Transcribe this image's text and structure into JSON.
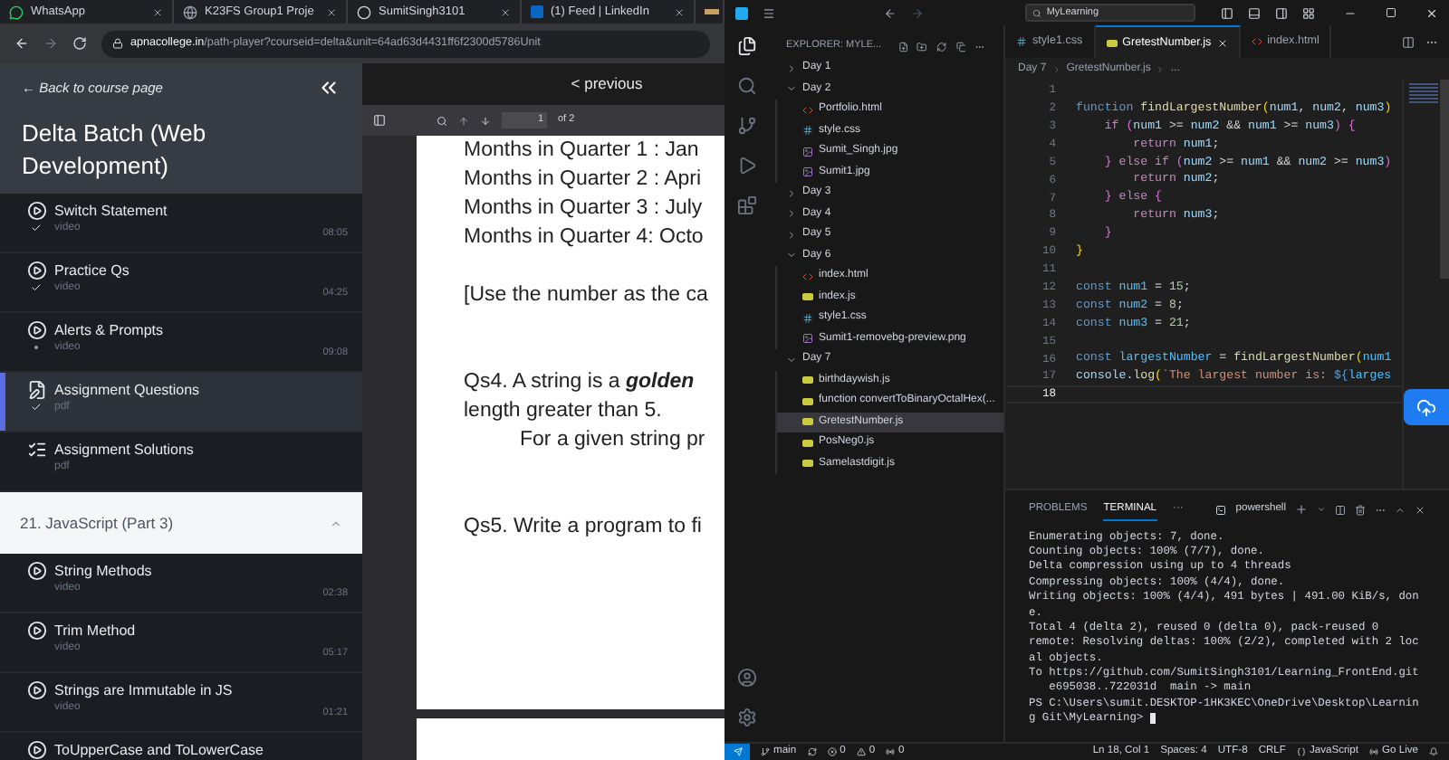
{
  "browser": {
    "tabs": [
      {
        "kind": "chat",
        "title": "WhatsApp"
      },
      {
        "kind": "globe",
        "title": "K23FS Group1 Proje"
      },
      {
        "kind": "ring",
        "title": "SumitSingh3101"
      },
      {
        "kind": "square",
        "title": "(1) Feed | LinkedIn"
      },
      {
        "kind": "bar"
      }
    ],
    "address": {
      "host": "apnacollege.in",
      "path": "/path-player?courseid=delta&unit=64ad63d4431ff6f2300d5786Unit"
    }
  },
  "course": {
    "back": "← Back to course page",
    "title": "Delta Batch (Web Development)",
    "lessons": [
      {
        "kind": "video",
        "title": "Switch Statement",
        "type": "video",
        "duration": "08:05",
        "done": true,
        "in_progress": false,
        "selected": false
      },
      {
        "kind": "video",
        "title": "Practice Qs",
        "type": "video",
        "duration": "04:25",
        "done": true,
        "in_progress": false,
        "selected": false
      },
      {
        "kind": "video",
        "title": "Alerts & Prompts",
        "type": "video",
        "duration": "09:08",
        "done": false,
        "in_progress": true,
        "selected": false
      },
      {
        "kind": "assignment",
        "title": "Assignment Questions",
        "type": "pdf",
        "done": true,
        "in_progress": false,
        "selected": true
      },
      {
        "kind": "solutions",
        "title": "Assignment Solutions",
        "type": "pdf",
        "done": false,
        "in_progress": false,
        "selected": false
      }
    ],
    "section": {
      "title": "21. JavaScript (Part 3)",
      "expanded": true,
      "lessons": [
        {
          "kind": "video",
          "title": "String Methods",
          "type": "video",
          "duration": "02:38",
          "done": false,
          "in_progress": false,
          "selected": false
        },
        {
          "kind": "video",
          "title": "Trim Method",
          "type": "video",
          "duration": "05:17",
          "done": false,
          "in_progress": false,
          "selected": false
        },
        {
          "kind": "video",
          "title": "Strings are Immutable in JS",
          "type": "video",
          "duration": "01:21",
          "done": false,
          "in_progress": false,
          "selected": false
        },
        {
          "kind": "video",
          "title": "ToUpperCase and ToLowerCase",
          "selected": false
        }
      ]
    }
  },
  "pdf": {
    "previous": "< previous",
    "page": "1",
    "of": "of 2",
    "paragraphs": [
      {
        "kind": "line",
        "text": "Months in Quarter 1 : Jan"
      },
      {
        "kind": "line",
        "text": "Months in Quarter 2 : Apri"
      },
      {
        "kind": "line",
        "text": "Months in Quarter 3 : July"
      },
      {
        "kind": "line",
        "text": "Months in Quarter 4: Octo"
      },
      {
        "kind": "gap"
      },
      {
        "kind": "line",
        "text": "[Use the number as the ca"
      },
      {
        "kind": "gap"
      },
      {
        "kind": "gap"
      },
      {
        "kind": "line",
        "text": "Qs4. A string is a **golden**"
      },
      {
        "kind": "line",
        "text": "length greater than 5."
      },
      {
        "kind": "indent",
        "text": "For a given string pr"
      },
      {
        "kind": "gap"
      },
      {
        "kind": "gap"
      },
      {
        "kind": "line",
        "text": "Qs5. Write a program to fi"
      }
    ]
  },
  "vscode": {
    "search": "MyLearning",
    "explorer_title": "EXPLORER: MYLE...",
    "tree": [
      {
        "name": "Day 1",
        "expanded": false,
        "selected": false
      },
      {
        "name": "Day 2",
        "expanded": true,
        "selected": false,
        "children": [
          {
            "name": "Portfolio.html",
            "kind": "html",
            "selected": false
          },
          {
            "name": "style.css",
            "kind": "css",
            "selected": false
          },
          {
            "name": "Sumit_Singh.jpg",
            "kind": "image",
            "selected": false
          },
          {
            "name": "Sumit1.jpg",
            "kind": "image",
            "selected": false
          }
        ]
      },
      {
        "name": "Day 3",
        "expanded": false,
        "selected": false
      },
      {
        "name": "Day 4",
        "expanded": false,
        "selected": false
      },
      {
        "name": "Day 5",
        "expanded": false,
        "selected": false
      },
      {
        "name": "Day 6",
        "expanded": true,
        "selected": false,
        "children": [
          {
            "name": "index.html",
            "kind": "html",
            "selected": false
          },
          {
            "name": "index.js",
            "kind": "js",
            "selected": false
          },
          {
            "name": "style1.css",
            "kind": "css",
            "selected": false
          },
          {
            "name": "Sumit1-removebg-preview.png",
            "kind": "image",
            "selected": false
          }
        ]
      },
      {
        "name": "Day 7",
        "expanded": true,
        "selected": false,
        "children": [
          {
            "name": "birthdaywish.js",
            "kind": "js",
            "selected": false
          },
          {
            "name": "function convertToBinaryOctalHex(...",
            "kind": "js",
            "selected": false
          },
          {
            "name": "GretestNumber.js",
            "kind": "js",
            "selected": true
          },
          {
            "name": "PosNeg0.js",
            "kind": "js",
            "selected": false
          },
          {
            "name": "Samelastdigit.js",
            "kind": "js",
            "selected": false
          }
        ]
      }
    ],
    "tabs": [
      {
        "name": "style1.css",
        "kind": "css",
        "selected": false
      },
      {
        "name": "GretestNumber.js",
        "kind": "js",
        "selected": true
      },
      {
        "name": "index.html",
        "kind": "html",
        "selected": false
      }
    ],
    "breadcrumb": [
      "Day 7",
      "GretestNumber.js",
      "..."
    ],
    "code": [
      {
        "number": "1",
        "current": false
      },
      {
        "number": "2",
        "current": false,
        "tokens": [
          {
            "kind": "storage",
            "text": "function"
          },
          {
            "kind": "fn",
            "text": " findLargestNumber"
          },
          {
            "kind": "bracket1",
            "text": "("
          },
          {
            "kind": "var",
            "text": "num1"
          },
          {
            "kind": "plain",
            "text": ", "
          },
          {
            "kind": "var",
            "text": "num2"
          },
          {
            "kind": "plain",
            "text": ", "
          },
          {
            "kind": "var",
            "text": "num3"
          },
          {
            "kind": "bracket1",
            "text": ")"
          }
        ]
      },
      {
        "number": "3",
        "current": false,
        "tokens": [
          {
            "kind": "control",
            "text": "    if"
          },
          {
            "kind": "bracket2",
            "text": " ("
          },
          {
            "kind": "var",
            "text": "num1"
          },
          {
            "kind": "plain",
            "text": " >= "
          },
          {
            "kind": "var",
            "text": "num2"
          },
          {
            "kind": "plain",
            "text": " && "
          },
          {
            "kind": "var",
            "text": "num1"
          },
          {
            "kind": "plain",
            "text": " >= "
          },
          {
            "kind": "var",
            "text": "num3"
          },
          {
            "kind": "bracket2",
            "text": ") {"
          }
        ]
      },
      {
        "number": "4",
        "current": false,
        "tokens": [
          {
            "kind": "control",
            "text": "        return"
          },
          {
            "kind": "var",
            "text": " num1"
          },
          {
            "kind": "plain",
            "text": ";"
          }
        ]
      },
      {
        "number": "5",
        "current": false,
        "tokens": [
          {
            "kind": "bracket2",
            "text": "    }"
          },
          {
            "kind": "control",
            "text": " else if"
          },
          {
            "kind": "bracket2",
            "text": " ("
          },
          {
            "kind": "var",
            "text": "num2"
          },
          {
            "kind": "plain",
            "text": " >= "
          },
          {
            "kind": "var",
            "text": "num1"
          },
          {
            "kind": "plain",
            "text": " && "
          },
          {
            "kind": "var",
            "text": "num2"
          },
          {
            "kind": "plain",
            "text": " >= "
          },
          {
            "kind": "var",
            "text": "num3"
          },
          {
            "kind": "bracket2",
            "text": ")"
          }
        ]
      },
      {
        "number": "6",
        "current": false,
        "tokens": [
          {
            "kind": "control",
            "text": "        return"
          },
          {
            "kind": "var",
            "text": " num2"
          },
          {
            "kind": "plain",
            "text": ";"
          }
        ]
      },
      {
        "number": "7",
        "current": false,
        "tokens": [
          {
            "kind": "bracket2",
            "text": "    }"
          },
          {
            "kind": "control",
            "text": " else"
          },
          {
            "kind": "bracket2",
            "text": " {"
          }
        ]
      },
      {
        "number": "8",
        "current": false,
        "tokens": [
          {
            "kind": "control",
            "text": "        return"
          },
          {
            "kind": "var",
            "text": " num3"
          },
          {
            "kind": "plain",
            "text": ";"
          }
        ]
      },
      {
        "number": "9",
        "current": false,
        "tokens": [
          {
            "kind": "bracket2",
            "text": "    }"
          }
        ]
      },
      {
        "number": "10",
        "current": false,
        "tokens": [
          {
            "kind": "bracket1",
            "text": "}"
          }
        ]
      },
      {
        "number": "11",
        "current": false
      },
      {
        "number": "12",
        "current": false,
        "tokens": [
          {
            "kind": "storage",
            "text": "const"
          },
          {
            "kind": "const",
            "text": " num1"
          },
          {
            "kind": "plain",
            "text": " = "
          },
          {
            "kind": "num",
            "text": "15"
          },
          {
            "kind": "plain",
            "text": ";"
          }
        ]
      },
      {
        "number": "13",
        "current": false,
        "tokens": [
          {
            "kind": "storage",
            "text": "const"
          },
          {
            "kind": "const",
            "text": " num2"
          },
          {
            "kind": "plain",
            "text": " = "
          },
          {
            "kind": "num",
            "text": "8"
          },
          {
            "kind": "plain",
            "text": ";"
          }
        ]
      },
      {
        "number": "14",
        "current": false,
        "tokens": [
          {
            "kind": "storage",
            "text": "const"
          },
          {
            "kind": "const",
            "text": " num3"
          },
          {
            "kind": "plain",
            "text": " = "
          },
          {
            "kind": "num",
            "text": "21"
          },
          {
            "kind": "plain",
            "text": ";"
          }
        ]
      },
      {
        "number": "15",
        "current": false
      },
      {
        "number": "16",
        "current": false,
        "tokens": [
          {
            "kind": "storage",
            "text": "const"
          },
          {
            "kind": "const",
            "text": " largestNumber"
          },
          {
            "kind": "plain",
            "text": " = "
          },
          {
            "kind": "fn",
            "text": "findLargestNumber"
          },
          {
            "kind": "bracket1",
            "text": "("
          },
          {
            "kind": "const",
            "text": "num1"
          }
        ]
      },
      {
        "number": "17",
        "current": false,
        "tokens": [
          {
            "kind": "var",
            "text": "console."
          },
          {
            "kind": "fn",
            "text": "log"
          },
          {
            "kind": "bracket1",
            "text": "("
          },
          {
            "kind": "str",
            "text": "`The largest number is: "
          },
          {
            "kind": "storage",
            "text": "${"
          },
          {
            "kind": "const",
            "text": "larges"
          }
        ]
      },
      {
        "number": "18",
        "current": true
      }
    ],
    "panel_tabs": [
      {
        "name": "PROBLEMS",
        "selected": false
      },
      {
        "name": "TERMINAL",
        "selected": true
      },
      {
        "name": "···",
        "selected": false
      }
    ],
    "shell": "powershell",
    "terminal": [
      "Enumerating objects: 7, done.",
      "Counting objects: 100% (7/7), done.",
      "Delta compression using up to 4 threads",
      "Compressing objects: 100% (4/4), done.",
      "Writing objects: 100% (4/4), 491 bytes | 491.00 KiB/s, don",
      "e.",
      "Total 4 (delta 2), reused 0 (delta 0), pack-reused 0",
      "remote: Resolving deltas: 100% (2/2), completed with 2 loc",
      "al objects.",
      "To https://github.com/SumitSingh3101/Learning_FrontEnd.git",
      "   e695038..722031d  main -> main",
      "PS C:\\Users\\sumit.DESKTOP-1HK3KEC\\OneDrive\\Desktop\\Learnin",
      "g Git\\MyLearning> "
    ],
    "status": {
      "branch": "main",
      "errors": "0",
      "warnings": "0",
      "ports": "0",
      "right": [
        {
          "kind": "text",
          "text": "Ln 18, Col 1"
        },
        {
          "kind": "text",
          "text": "Spaces: 4"
        },
        {
          "kind": "text",
          "text": "UTF-8"
        },
        {
          "kind": "text",
          "text": "CRLF"
        },
        {
          "kind": "language",
          "text": "JavaScript"
        },
        {
          "kind": "golive",
          "text": "Go Live"
        },
        {
          "kind": "bell"
        }
      ]
    }
  }
}
